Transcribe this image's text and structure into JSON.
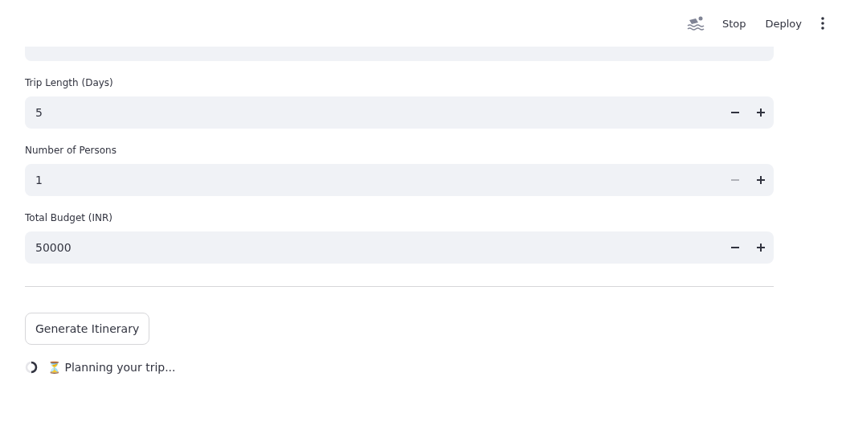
{
  "header": {
    "stop": "Stop",
    "deploy": "Deploy"
  },
  "fields": [
    {
      "kind": "text"
    },
    {
      "kind": "number",
      "label": "Trip Length (Days)",
      "value": "5",
      "decrement_disabled": false
    },
    {
      "kind": "number",
      "label": "Number of Persons",
      "value": "1",
      "decrement_disabled": true
    },
    {
      "kind": "number",
      "label": "Total Budget (INR)",
      "value": "50000",
      "decrement_disabled": false
    }
  ],
  "generate_button": "Generate Itinerary",
  "status": "⏳ Planning your trip..."
}
